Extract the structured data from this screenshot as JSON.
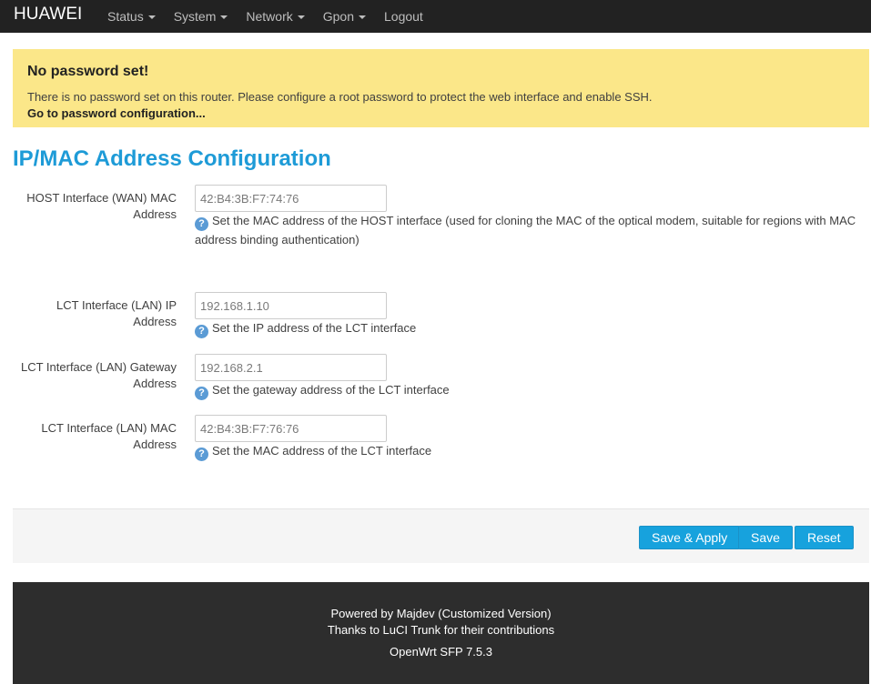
{
  "navbar": {
    "brand": "HUAWEI",
    "items": [
      {
        "label": "Status",
        "dropdown": true
      },
      {
        "label": "System",
        "dropdown": true
      },
      {
        "label": "Network",
        "dropdown": true
      },
      {
        "label": "Gpon",
        "dropdown": true
      },
      {
        "label": "Logout",
        "dropdown": false
      }
    ]
  },
  "alert": {
    "title": "No password set!",
    "text": "There is no password set on this router. Please configure a root password to protect the web interface and enable SSH.",
    "link": "Go to password configuration..."
  },
  "page": {
    "title": "IP/MAC Address Configuration"
  },
  "fields": [
    {
      "label": "HOST Interface (WAN) MAC Address",
      "value": "42:B4:3B:F7:74:76",
      "help": "Set the MAC address of the HOST interface (used for cloning the MAC of the optical modem, suitable for regions with MAC address binding authentication)"
    },
    {
      "label": "LCT Interface (LAN) IP Address",
      "value": "192.168.1.10",
      "help": "Set the IP address of the LCT interface"
    },
    {
      "label": "LCT Interface (LAN) Gateway Address",
      "value": "192.168.2.1",
      "help": "Set the gateway address of the LCT interface"
    },
    {
      "label": "LCT Interface (LAN) MAC Address",
      "value": "42:B4:3B:F7:76:76",
      "help": "Set the MAC address of the LCT interface"
    }
  ],
  "actions": {
    "save_apply": "Save & Apply",
    "save": "Save",
    "reset": "Reset"
  },
  "footer": {
    "line1": "Powered by Majdev (Customized Version)",
    "line2": "Thanks to LuCI Trunk for their contributions",
    "line3": "OpenWrt SFP 7.5.3"
  },
  "colors": {
    "accent": "#1e9bd7",
    "button": "#17a2dd",
    "alert_bg": "#fbe789",
    "navbar_bg": "#222222",
    "footer_bg": "#2d2d2d"
  }
}
